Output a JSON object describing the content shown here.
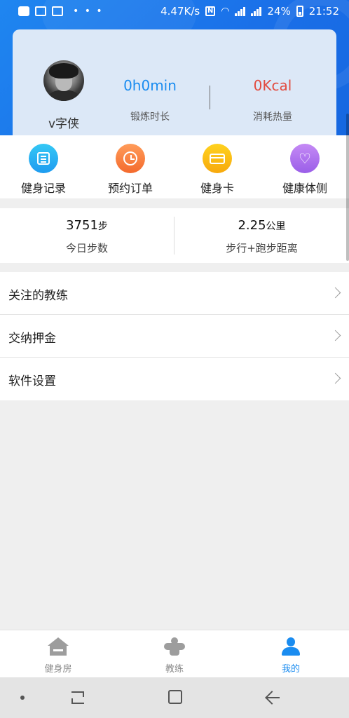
{
  "status_bar": {
    "net_speed": "4.47K/s",
    "battery": "24%",
    "time": "21:52"
  },
  "profile": {
    "username": "v字侠",
    "exercise_value": "0h0min",
    "exercise_label": "锻炼时长",
    "calories_value": "0Kcal",
    "calories_label": "消耗热量"
  },
  "quick_menu": [
    {
      "label": "健身记录",
      "icon": "fitness-record-icon",
      "color": "#1e9bf0"
    },
    {
      "label": "预约订单",
      "icon": "clock-icon",
      "color": "#f46a2d"
    },
    {
      "label": "健身卡",
      "icon": "card-icon",
      "color": "#f7a90c"
    },
    {
      "label": "健康体侧",
      "icon": "heart-icon",
      "color": "#9a5ee8"
    }
  ],
  "steps": {
    "steps_value": "3751",
    "steps_unit": "步",
    "steps_label": "今日步数",
    "distance_value": "2.25",
    "distance_unit": "公里",
    "distance_label": "步行+跑步距离"
  },
  "menu_list": [
    {
      "label": "关注的教练"
    },
    {
      "label": "交纳押金"
    },
    {
      "label": "软件设置"
    }
  ],
  "tabs": [
    {
      "label": "健身房",
      "active": false
    },
    {
      "label": "教练",
      "active": false
    },
    {
      "label": "我的",
      "active": true
    }
  ],
  "colors": {
    "primary": "#1a8cf0",
    "calorie": "#e24b3f"
  }
}
